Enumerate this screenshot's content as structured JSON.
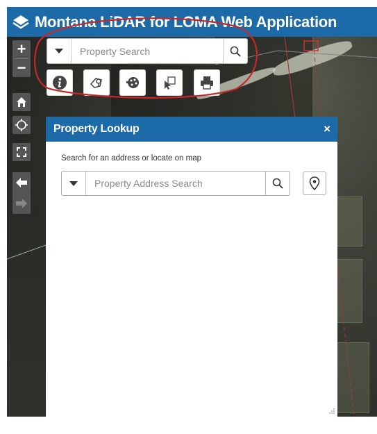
{
  "header": {
    "title": "Montana LiDAR for LOMA Web Application",
    "logo_icon": "layers-logo-icon",
    "color": "#1c6aa7"
  },
  "map_controls": {
    "zoom_in_label": "+",
    "zoom_out_label": "−",
    "home_icon": "home-icon",
    "locate_icon": "locate-icon",
    "fullscreen_icon": "fullscreen-icon",
    "back_icon": "arrow-left-icon",
    "forward_icon": "arrow-right-icon"
  },
  "search": {
    "placeholder": "Property Search",
    "dropdown_icon": "caret-down-icon",
    "search_icon": "search-icon"
  },
  "tools": [
    {
      "icon": "info-icon"
    },
    {
      "icon": "map-tag-icon"
    },
    {
      "icon": "palette-icon"
    },
    {
      "icon": "cursor-select-icon"
    },
    {
      "icon": "print-icon"
    }
  ],
  "panel": {
    "title": "Property Lookup",
    "close_label": "×",
    "instruction": "Search for an address or locate on map",
    "search_placeholder": "Property Address Search",
    "locate_icon": "map-pin-icon"
  },
  "annotation": {
    "color": "#c62828"
  }
}
